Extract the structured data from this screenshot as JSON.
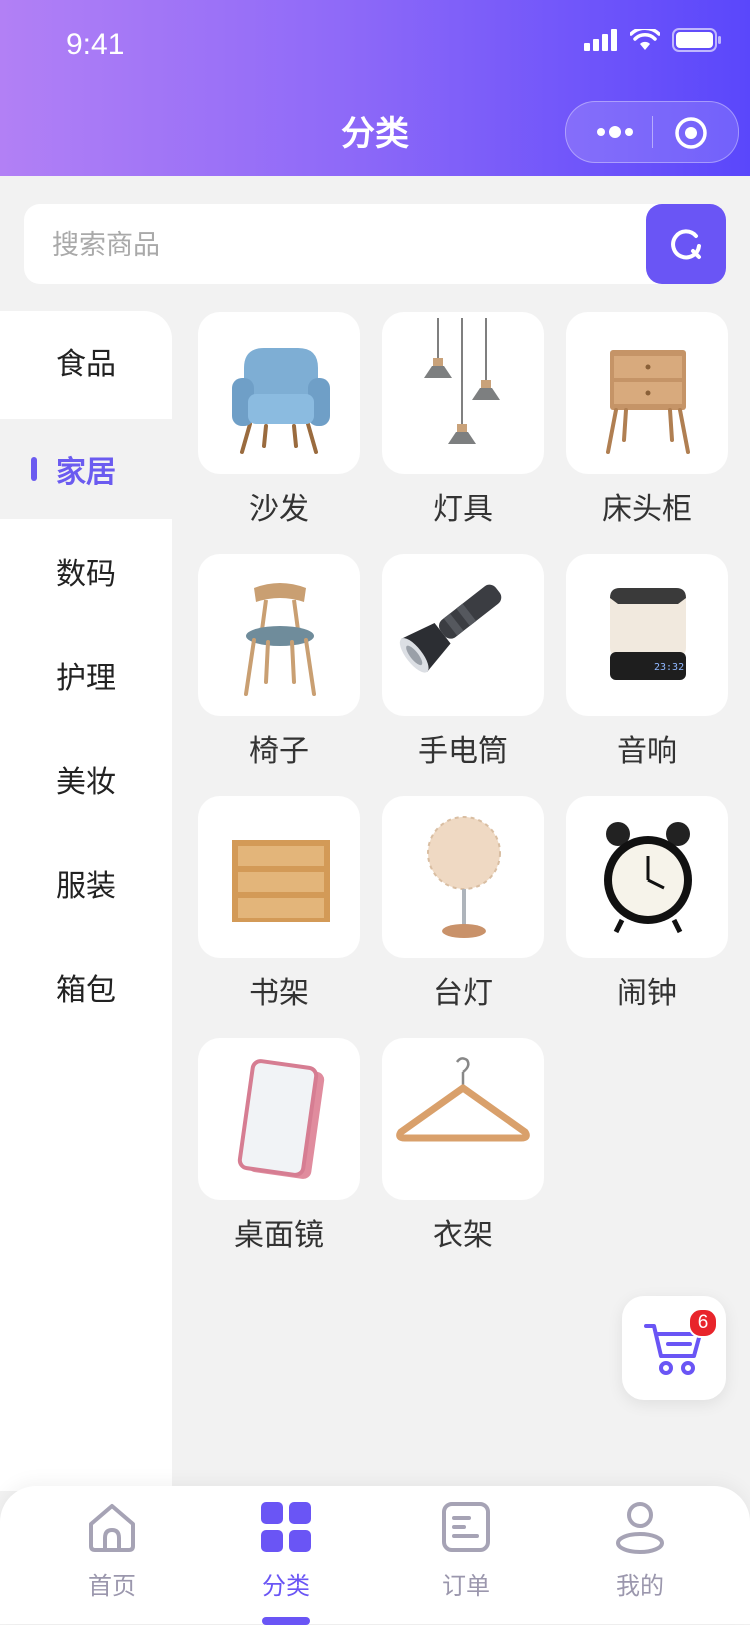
{
  "status_bar": {
    "time": "9:41"
  },
  "nav": {
    "title": "分类"
  },
  "search": {
    "placeholder": "搜索商品"
  },
  "sidebar": {
    "items": [
      {
        "label": "食品"
      },
      {
        "label": "家居",
        "active": true
      },
      {
        "label": "数码"
      },
      {
        "label": "护理"
      },
      {
        "label": "美妆"
      },
      {
        "label": "服装"
      },
      {
        "label": "箱包"
      }
    ]
  },
  "products": [
    {
      "label": "沙发",
      "icon": "armchair-image"
    },
    {
      "label": "灯具",
      "icon": "pendant-lamp-image"
    },
    {
      "label": "床头柜",
      "icon": "nightstand-image"
    },
    {
      "label": "椅子",
      "icon": "chair-image"
    },
    {
      "label": "手电筒",
      "icon": "flashlight-image"
    },
    {
      "label": "音响",
      "icon": "speaker-image"
    },
    {
      "label": "书架",
      "icon": "bookshelf-image"
    },
    {
      "label": "台灯",
      "icon": "table-lamp-image"
    },
    {
      "label": "闹钟",
      "icon": "alarm-clock-image"
    },
    {
      "label": "桌面镜",
      "icon": "desk-mirror-image"
    },
    {
      "label": "衣架",
      "icon": "hanger-image"
    }
  ],
  "cart": {
    "badge": "6"
  },
  "tabbar": {
    "items": [
      {
        "label": "首页",
        "icon": "home-icon"
      },
      {
        "label": "分类",
        "icon": "category-icon",
        "active": true
      },
      {
        "label": "订单",
        "icon": "order-icon"
      },
      {
        "label": "我的",
        "icon": "user-icon"
      }
    ]
  },
  "colors": {
    "accent": "#6a55f5",
    "background": "#f2f2f2",
    "badge": "#e8242b"
  }
}
